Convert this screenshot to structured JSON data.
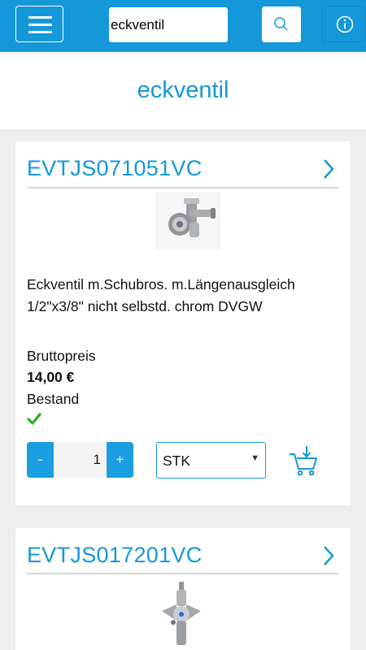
{
  "header": {
    "search_value": "eckventil",
    "menu_icon": "hamburger-menu-icon",
    "search_icon": "search-icon",
    "info_icon": "info-icon",
    "accent_color": "#1598d9"
  },
  "page": {
    "title": "eckventil"
  },
  "products": [
    {
      "sku": "EVTJS071051VC",
      "description_line1": "Eckventil m.Schubros. m.Längenausgleich",
      "description_line2": "1/2\"x3/8\" nicht selbstd. chrom DVGW",
      "price_label": "Bruttopreis",
      "price": "14,00 €",
      "stock_label": "Bestand",
      "stock_status": "available",
      "qty_minus": "-",
      "qty_value": "1",
      "qty_plus": "+",
      "unit": "STK",
      "cart_icon": "add-to-cart-icon"
    },
    {
      "sku": "EVTJS017201VC"
    }
  ]
}
